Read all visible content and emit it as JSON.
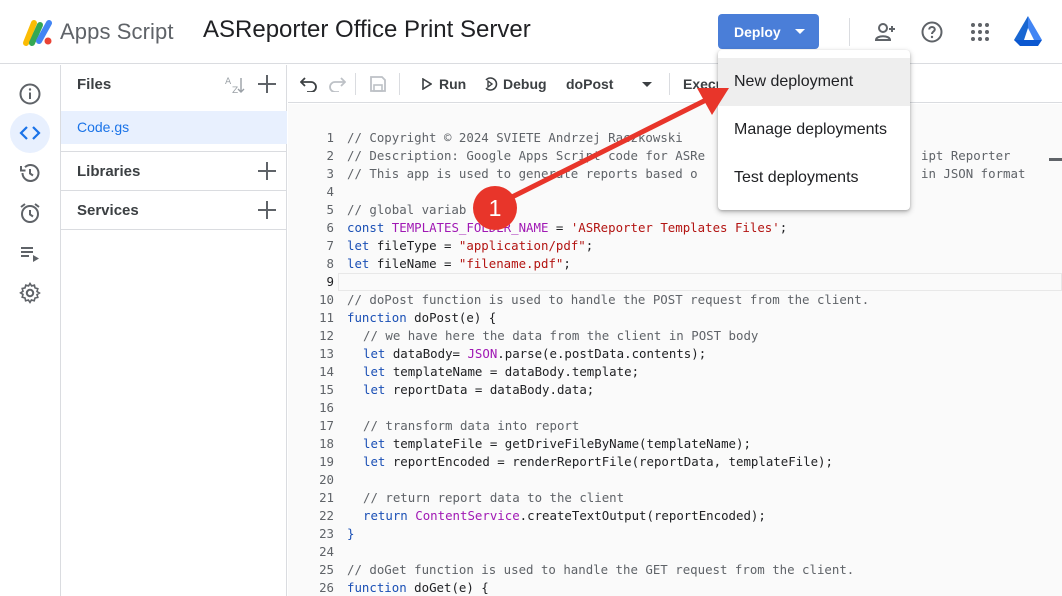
{
  "header": {
    "app_name": "Apps Script",
    "project_title": "ASReporter Office Print Server",
    "deploy_label": "Deploy",
    "icons": [
      "add-person-icon",
      "help-icon",
      "apps-grid-icon",
      "drive-icon"
    ]
  },
  "sidebar": {
    "icons": [
      "info-icon",
      "code-icon",
      "history-icon",
      "alarm-icon",
      "executions-icon",
      "settings-icon"
    ],
    "active_color": "#e8f0fe"
  },
  "files_panel": {
    "title": "Files",
    "files": [
      {
        "name": "Code.gs"
      }
    ],
    "sections": [
      {
        "label": "Libraries"
      },
      {
        "label": "Services"
      }
    ]
  },
  "toolbar": {
    "run_label": "Run",
    "debug_label": "Debug",
    "function_name": "doPost",
    "execution_label": "Execu"
  },
  "deploy_menu": {
    "items": [
      {
        "label": "New deployment"
      },
      {
        "label": "Manage deployments"
      },
      {
        "label": "Test deployments"
      }
    ]
  },
  "annotation": {
    "badge": "1",
    "color": "#e8352a"
  },
  "colors": {
    "deploy_button": "#4a7ed8",
    "selected_file": "#1a73e8",
    "keyword": "#1a4fb5",
    "string": "#b31412",
    "comment": "#5f6368"
  },
  "code_lines": [
    "1",
    "2",
    "3",
    "4",
    "5",
    "6",
    "7",
    "8",
    "9",
    "10",
    "11",
    "12",
    "13",
    "14",
    "15",
    "16",
    "17",
    "18",
    "19",
    "20",
    "21",
    "22",
    "23",
    "24",
    "25",
    "26"
  ],
  "code": {
    "l1": "// Copyright © 2024 SVIETE Andrzej R",
    "l1b": "aczkowski",
    "l2a": "// Description: Google Apps Script code for ASRe",
    "l2b": "ipt Reporter",
    "l3a": "// This app is used to gene",
    "l3b": "rate reports based o",
    "l3c": "in JSON format",
    "l5": "// global variab",
    "l6_kw": "const",
    "l6_id": "TEMPLATES_FOLDER_NAME",
    "l6_eq": " = ",
    "l6_str": "'ASReporter Templates Files'",
    "l6_end": ";",
    "l7_kw": "let",
    "l7_id": " fileType = ",
    "l7_str": "\"application/pdf\"",
    "l7_end": ";",
    "l8_kw": "let",
    "l8_id": " fileName = ",
    "l8_str": "\"filename.pdf\"",
    "l8_end": ";",
    "l10": "// doPost function is used to handle the POST request from the client.",
    "l11_kw": "function",
    "l11_rest": " doPost(e) {",
    "l12": "// we have here the data from the client in POST body",
    "l13_kw": "let",
    "l13_a": " dataBody= ",
    "l13_cn": "JSON",
    "l13_b": ".parse(e.postData.contents);",
    "l14_kw": "let",
    "l14_rest": " templateName = dataBody.template;",
    "l15_kw": "let",
    "l15_rest": " reportData = dataBody.data;",
    "l17": "// transform data into report",
    "l18_kw": "let",
    "l18_rest": " templateFile = getDriveFileByName(templateName);",
    "l19_kw": "let",
    "l19_rest": " reportEncoded = renderReportFile(reportData, templateFile);",
    "l21": "// return report data to the client",
    "l22_kw": "return",
    "l22_cn": "ContentService",
    "l22_rest": ".createTextOutput(reportEncoded);",
    "l23": "}",
    "l25": "// doGet function is used to handle the GET request from the client.",
    "l26_kw": "function",
    "l26_rest": " doGet(e) {"
  }
}
